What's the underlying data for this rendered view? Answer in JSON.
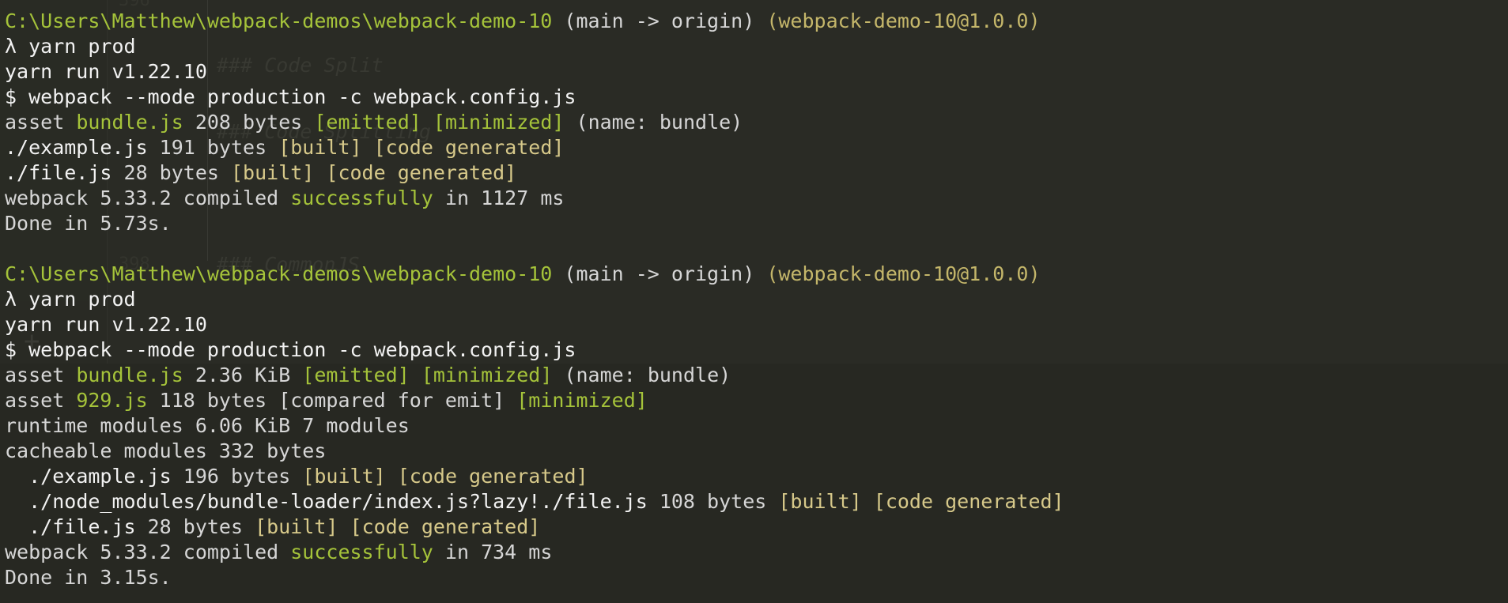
{
  "colors": {
    "background": "#272822",
    "text": "#d6d6d6",
    "path_green": "#a5c33a",
    "bracket_tan": "#d7c98a"
  },
  "ghost_editor": {
    "line_number_top": "396",
    "heading_code_split": "### Code Split",
    "heading_code_splitting": "### Code Splitting",
    "heading_commonjs": "### CommonJS",
    "line_number_mid": "398",
    "line_number_low": "398",
    "plus_glyph": "+"
  },
  "run1": {
    "path": "C:\\Users\\Matthew\\webpack-demos\\webpack-demo-10",
    "branch": "(main -> origin)",
    "pkg": "(webpack-demo-10@1.0.0)",
    "prompt": "λ yarn prod",
    "yarn_version": "yarn run v1.22.10",
    "command": "$ webpack --mode production -c webpack.config.js",
    "asset_bundle": {
      "prefix": "asset ",
      "file": "bundle.js",
      "size": " 208 bytes ",
      "flag1": "[emitted]",
      "flag2": "[minimized]",
      "name": " (name: bundle)"
    },
    "module_example": {
      "file": "./example.js",
      "size": " 191 bytes ",
      "flag1": "[built]",
      "flag2": "[code generated]"
    },
    "module_file": {
      "file": "./file.js",
      "size": " 28 bytes ",
      "flag1": "[built]",
      "flag2": "[code generated]"
    },
    "compiled": {
      "prefix": "webpack 5.33.2 compiled ",
      "status": "successfully",
      "suffix": " in 1127 ms"
    },
    "done": "Done in 5.73s."
  },
  "run2": {
    "path": "C:\\Users\\Matthew\\webpack-demos\\webpack-demo-10",
    "branch": "(main -> origin)",
    "pkg": "(webpack-demo-10@1.0.0)",
    "prompt": "λ yarn prod",
    "yarn_version": "yarn run v1.22.10",
    "command": "$ webpack --mode production -c webpack.config.js",
    "asset_bundle": {
      "prefix": "asset ",
      "file": "bundle.js",
      "size": " 2.36 KiB ",
      "flag1": "[emitted]",
      "flag2": "[minimized]",
      "name": " (name: bundle)"
    },
    "asset_929": {
      "prefix": "asset ",
      "file": "929.js",
      "size": " 118 bytes ",
      "flag1": "[compared for emit]",
      "flag2": "[minimized]"
    },
    "runtime_modules": "runtime modules 6.06 KiB 7 modules",
    "cacheable_modules": "cacheable modules 332 bytes",
    "module_example": {
      "indent": "  ",
      "file": "./example.js",
      "size": " 196 bytes ",
      "flag1": "[built]",
      "flag2": "[code generated]"
    },
    "module_loader": {
      "indent": "  ",
      "file": "./node_modules/bundle-loader/index.js?lazy!./file.js",
      "size": " 108 bytes ",
      "flag1": "[built]",
      "flag2": "[code generated]"
    },
    "module_file": {
      "indent": "  ",
      "file": "./file.js",
      "size": " 28 bytes ",
      "flag1": "[built]",
      "flag2": "[code generated]"
    },
    "compiled": {
      "prefix": "webpack 5.33.2 compiled ",
      "status": "successfully",
      "suffix": " in 734 ms"
    },
    "done": "Done in 3.15s."
  }
}
